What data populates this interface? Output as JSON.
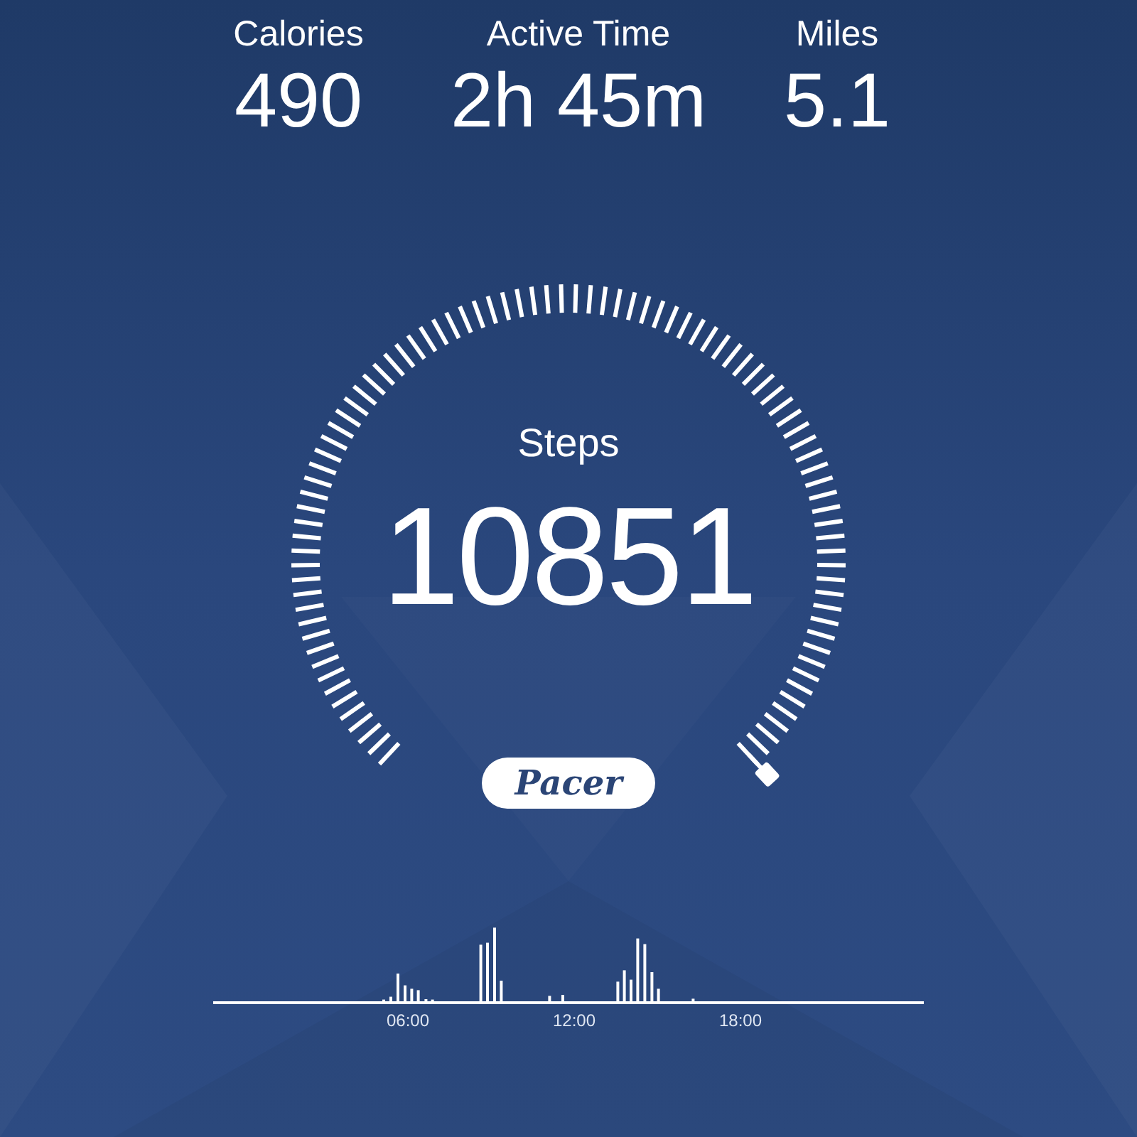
{
  "stats": [
    {
      "label": "Calories",
      "value": "490"
    },
    {
      "label": "Active Time",
      "value": "2h 45m"
    },
    {
      "label": "Miles",
      "value": "5.1"
    }
  ],
  "steps": {
    "label": "Steps",
    "value": "10851"
  },
  "logo": "Pacer",
  "activity_chart": {
    "ticks": [
      "06:00",
      "12:00",
      "18:00"
    ]
  }
}
